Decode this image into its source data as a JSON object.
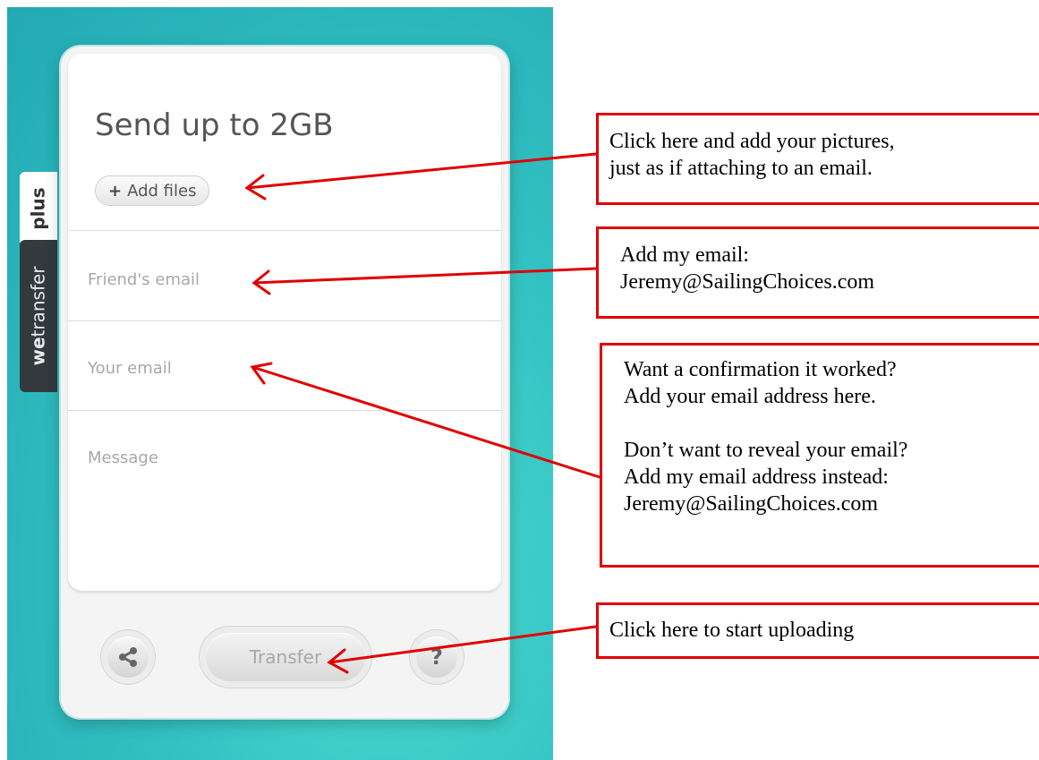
{
  "side_tabs": {
    "plus": "plus",
    "wetransfer_bold": "we",
    "wetransfer_rest": "transfer"
  },
  "panel": {
    "headline": "Send up to 2GB",
    "add_files_label": "Add files",
    "add_files_plus": "+",
    "friend_email_placeholder": "Friend's email",
    "your_email_placeholder": "Your email",
    "message_placeholder": "Message",
    "transfer_label": "Transfer",
    "help_glyph": "?",
    "share_icon": "share-icon"
  },
  "callouts": {
    "add_files": [
      "Click here and add your pictures,",
      "just as if attaching to an email."
    ],
    "friend_email": [
      "Add my email:",
      "Jeremy@SailingChoices.com"
    ],
    "your_email": [
      "Want a confirmation it worked?",
      "Add your email address here.",
      "Don’t want to reveal your email?",
      "Add my email address instead:",
      "Jeremy@SailingChoices.com"
    ],
    "transfer": [
      "Click here to start uploading"
    ]
  },
  "colors": {
    "teal": "#33c2c3",
    "callout_red": "#e00000",
    "tab_dark": "#333a3d"
  }
}
